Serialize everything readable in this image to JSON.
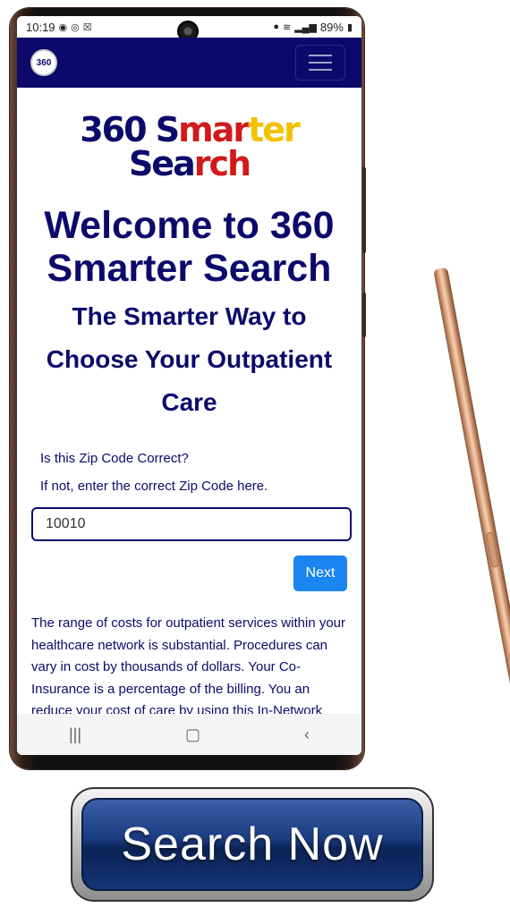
{
  "status_bar": {
    "time": "10:19",
    "battery": "89%"
  },
  "nav": {
    "logo_text": "360"
  },
  "brand": {
    "part1": "360 S",
    "part2": "mar",
    "part3": "ter",
    "part4": " Sea",
    "part5": "rch"
  },
  "welcome_title": "Welcome to 360 Smarter Search",
  "subtitle": "The Smarter Way to Choose Your Outpatient Care",
  "zip": {
    "question": "Is this Zip Code Correct?",
    "instruction": "If not, enter the correct Zip Code here.",
    "value": "10010"
  },
  "next_label": "Next",
  "description": "The range of costs for outpatient services within your healthcare network is substantial. Procedures can vary in cost by thousands of dollars. Your Co-Insurance is a percentage of the billing. You an reduce your cost of care by using this In-Network Smart Search Tool.",
  "search_now_label": "Search Now",
  "icons": {
    "android_recents": "recents-icon",
    "android_home": "home-icon",
    "android_back": "back-icon"
  }
}
